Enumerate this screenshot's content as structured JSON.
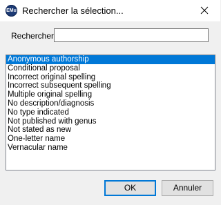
{
  "window": {
    "title": "Rechercher la sélection...",
    "app_icon_text": "EMu"
  },
  "search": {
    "label": "Rechercher :",
    "value": "",
    "placeholder": ""
  },
  "list": {
    "items": [
      "Anonymous authorship",
      "Conditional proposal",
      "Incorrect original spelling",
      "Incorrect subsequent spelling",
      "Multiple original spelling",
      "No description/diagnosis",
      "No type indicated",
      "Not published with genus",
      "Not stated as new",
      "One-letter name",
      "Vernacular name"
    ],
    "selected_index": 0
  },
  "buttons": {
    "ok": "OK",
    "cancel": "Annuler"
  },
  "colors": {
    "selection": "#0078d7",
    "dialog_bg": "#f0f0f0"
  }
}
